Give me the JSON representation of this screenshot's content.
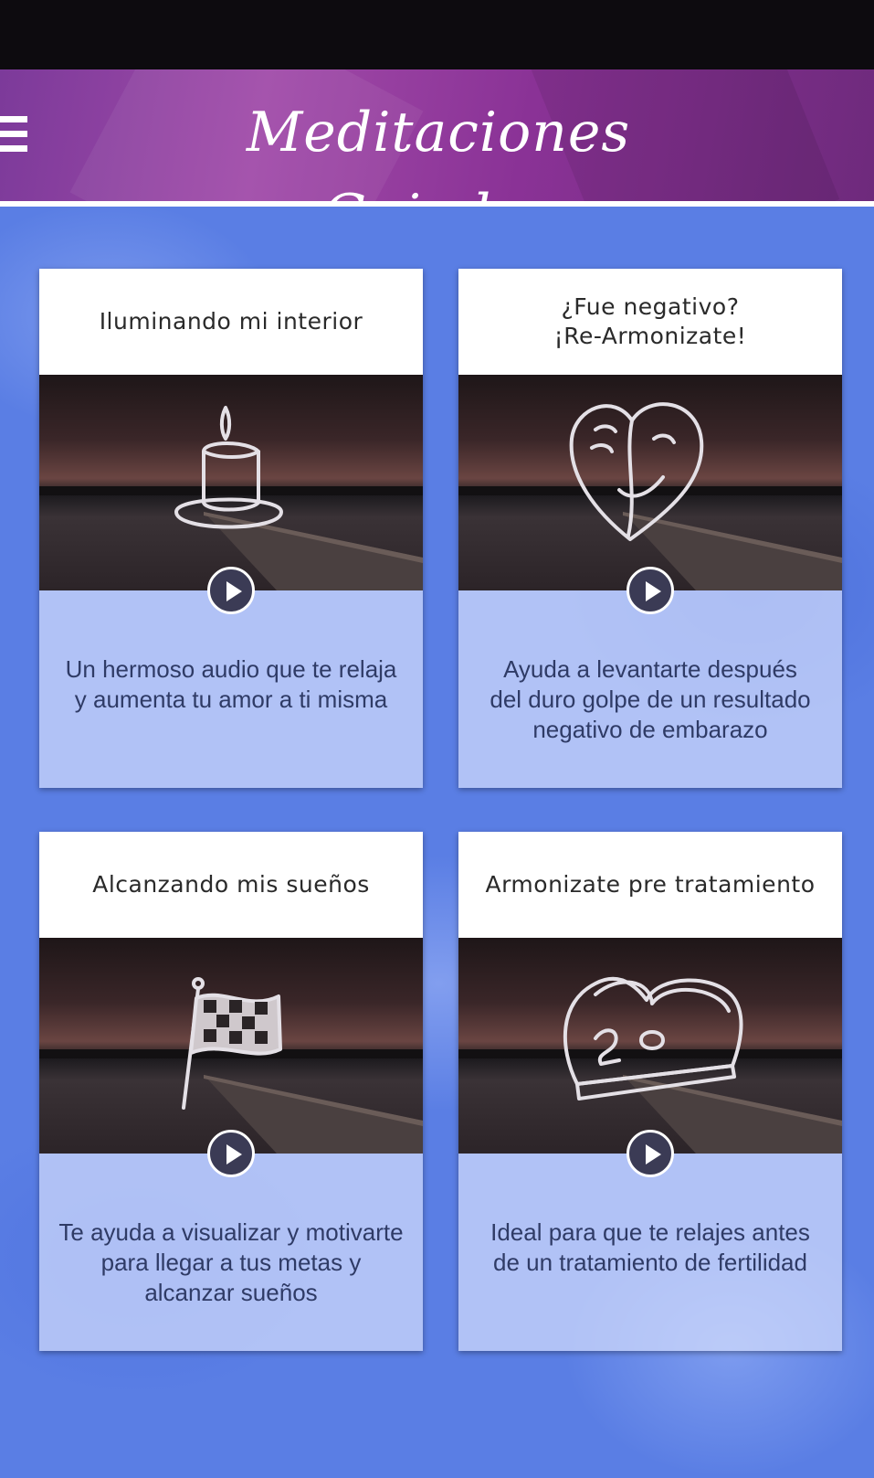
{
  "header": {
    "title": "Meditaciones Guiadas",
    "menu_icon": "hamburger-menu-icon"
  },
  "cards": [
    {
      "title": "Iluminando mi interior",
      "icon": "candle-icon",
      "description": "Un hermoso audio que te relaja\ny aumenta tu amor a ti misma"
    },
    {
      "title": "¿Fue negativo?\n¡Re-Armonizate!",
      "icon": "heart-faces-icon",
      "description": "Ayuda a levantarte después\ndel duro golpe de un resultado\nnegativo de embarazo"
    },
    {
      "title": "Alcanzando mis sueños",
      "icon": "checkered-flag-icon",
      "description": "Te ayuda a visualizar y motivarte\npara llegar a tus metas y\nalcanzar sueños"
    },
    {
      "title": "Armonizate pre tratamiento",
      "icon": "heart-box-icon",
      "description": "Ideal para que te relajes antes\nde un tratamiento de fertilidad"
    }
  ],
  "colors": {
    "header": "#8a3296",
    "background": "#5a7ee4",
    "play_button": "#3b3b55",
    "description_text": "#2f3b66"
  }
}
